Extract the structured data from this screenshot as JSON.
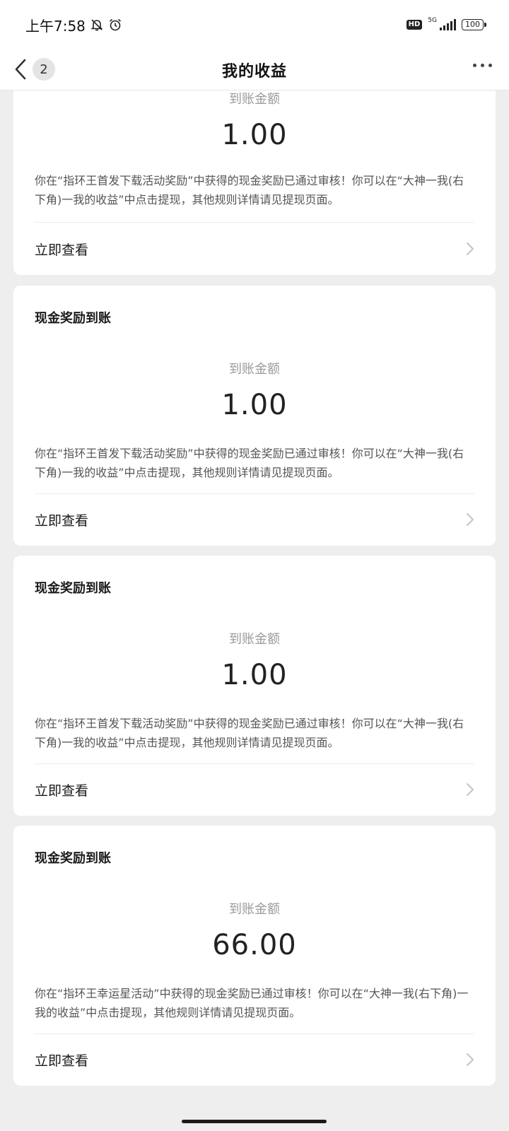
{
  "status_bar": {
    "time": "上午7:58",
    "network": "5G",
    "hd_badge": "HD",
    "battery": "100"
  },
  "header": {
    "back_count": "2",
    "title": "我的收益"
  },
  "cards": [
    {
      "title": "",
      "amount_label": "到账金额",
      "amount": "1.00",
      "description": "你在“指环王首发下载活动奖励”中获得的现金奖励已通过审核！你可以在“大神一我(右下角)一我的收益”中点击提现，其他规则详情请见提现页面。",
      "action_label": "立即查看"
    },
    {
      "title": "现金奖励到账",
      "amount_label": "到账金额",
      "amount": "1.00",
      "description": "你在“指环王首发下载活动奖励”中获得的现金奖励已通过审核！你可以在“大神一我(右下角)一我的收益”中点击提现，其他规则详情请见提现页面。",
      "action_label": "立即查看"
    },
    {
      "title": "现金奖励到账",
      "amount_label": "到账金额",
      "amount": "1.00",
      "description": "你在“指环王首发下载活动奖励”中获得的现金奖励已通过审核！你可以在“大神一我(右下角)一我的收益”中点击提现，其他规则详情请见提现页面。",
      "action_label": "立即查看"
    },
    {
      "title": "现金奖励到账",
      "amount_label": "到账金额",
      "amount": "66.00",
      "description": "你在“指环王幸运星活动”中获得的现金奖励已通过审核！你可以在“大神一我(右下角)一我的收益”中点击提现，其他规则详情请见提现页面。",
      "action_label": "立即查看"
    }
  ]
}
